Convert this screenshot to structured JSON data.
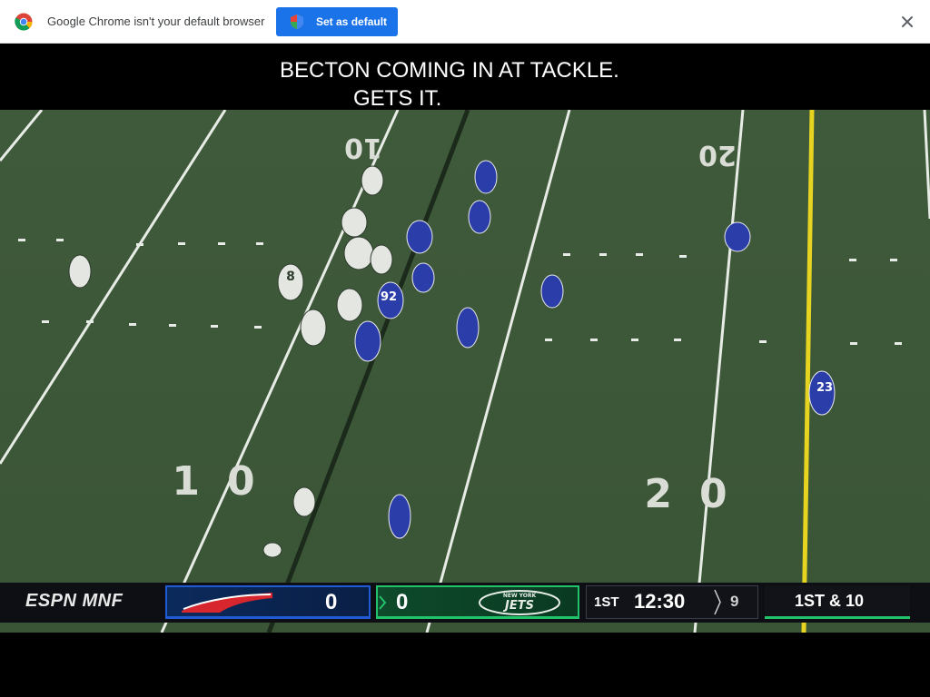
{
  "infobar": {
    "message": "Google Chrome isn't your default browser",
    "set_default_label": "Set as default",
    "icons": {
      "logo": "chrome-logo-icon",
      "shield": "shield-icon",
      "close": "close-icon"
    },
    "accent_color": "#1a73e8"
  },
  "video": {
    "caption_line1": "BECTON COMING IN AT TACKLE.",
    "caption_line2": "GETS IT.",
    "field": {
      "yard_numbers_far": [
        "10",
        "10",
        "20"
      ],
      "yard_numbers_near": [
        "10",
        "20"
      ],
      "player_numbers": [
        "8",
        "92",
        "23"
      ]
    },
    "scorebug": {
      "network": "ESPN MNF",
      "home_team": {
        "name": "Bills",
        "score": "0",
        "color": "#1e5bd4"
      },
      "away_team": {
        "name": "Jets",
        "logo_text": "JETS",
        "logo_top": "NEW YORK",
        "score": "0",
        "color": "#22c26a"
      },
      "quarter": "1ST",
      "clock": "12:30",
      "play_clock": "9",
      "down_distance": "1ST & 10"
    }
  }
}
